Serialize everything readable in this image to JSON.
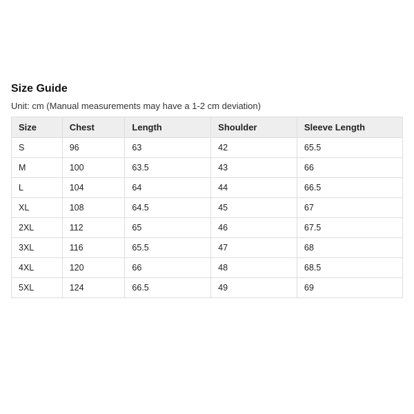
{
  "title": "Size Guide",
  "subtitle": "Unit: cm (Manual measurements may have a 1-2 cm deviation)",
  "chart_data": {
    "type": "table",
    "columns": [
      "Size",
      "Chest",
      "Length",
      "Shoulder",
      "Sleeve Length"
    ],
    "rows": [
      {
        "size": "S",
        "chest": "96",
        "length": "63",
        "shoulder": "42",
        "sleeve": "65.5"
      },
      {
        "size": "M",
        "chest": "100",
        "length": "63.5",
        "shoulder": "43",
        "sleeve": "66"
      },
      {
        "size": "L",
        "chest": "104",
        "length": "64",
        "shoulder": "44",
        "sleeve": "66.5"
      },
      {
        "size": "XL",
        "chest": "108",
        "length": "64.5",
        "shoulder": "45",
        "sleeve": "67"
      },
      {
        "size": "2XL",
        "chest": "112",
        "length": "65",
        "shoulder": "46",
        "sleeve": "67.5"
      },
      {
        "size": "3XL",
        "chest": "116",
        "length": "65.5",
        "shoulder": "47",
        "sleeve": "68"
      },
      {
        "size": "4XL",
        "chest": "120",
        "length": "66",
        "shoulder": "48",
        "sleeve": "68.5"
      },
      {
        "size": "5XL",
        "chest": "124",
        "length": "66.5",
        "shoulder": "49",
        "sleeve": "69"
      }
    ]
  }
}
